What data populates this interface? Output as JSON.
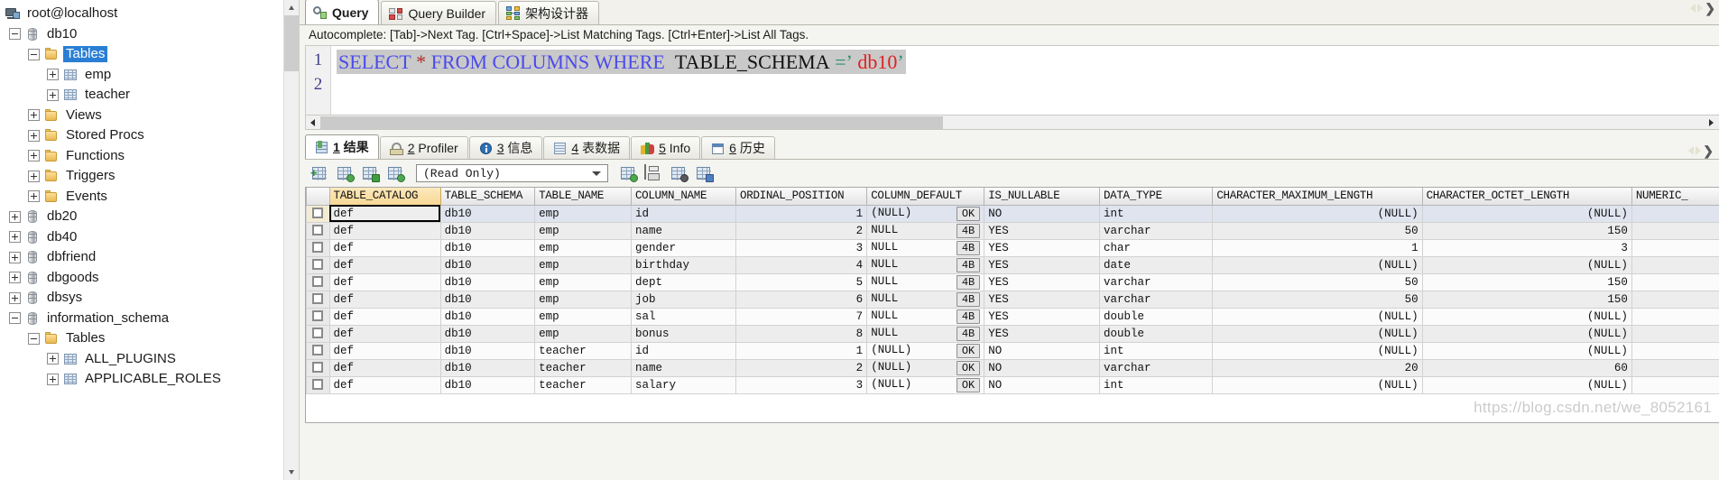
{
  "tree": {
    "root": {
      "label": "root@localhost",
      "icon": "server-icon"
    },
    "items": [
      {
        "label": "db10",
        "icon": "database-icon",
        "indent": 0,
        "expander": "minus",
        "selected": false
      },
      {
        "label": "Tables",
        "icon": "folder-icon",
        "indent": 1,
        "expander": "minus",
        "selected": true
      },
      {
        "label": "emp",
        "icon": "table-icon",
        "indent": 2,
        "expander": "plus",
        "selected": false
      },
      {
        "label": "teacher",
        "icon": "table-icon",
        "indent": 2,
        "expander": "plus",
        "selected": false
      },
      {
        "label": "Views",
        "icon": "folder-icon",
        "indent": 1,
        "expander": "plus",
        "selected": false
      },
      {
        "label": "Stored Procs",
        "icon": "folder-icon",
        "indent": 1,
        "expander": "plus",
        "selected": false
      },
      {
        "label": "Functions",
        "icon": "folder-icon",
        "indent": 1,
        "expander": "plus",
        "selected": false
      },
      {
        "label": "Triggers",
        "icon": "folder-icon",
        "indent": 1,
        "expander": "plus",
        "selected": false
      },
      {
        "label": "Events",
        "icon": "folder-icon",
        "indent": 1,
        "expander": "plus",
        "selected": false
      },
      {
        "label": "db20",
        "icon": "database-icon",
        "indent": 0,
        "expander": "plus",
        "selected": false
      },
      {
        "label": "db40",
        "icon": "database-icon",
        "indent": 0,
        "expander": "plus",
        "selected": false
      },
      {
        "label": "dbfriend",
        "icon": "database-icon",
        "indent": 0,
        "expander": "plus",
        "selected": false
      },
      {
        "label": "dbgoods",
        "icon": "database-icon",
        "indent": 0,
        "expander": "plus",
        "selected": false
      },
      {
        "label": "dbsys",
        "icon": "database-icon",
        "indent": 0,
        "expander": "plus",
        "selected": false
      },
      {
        "label": "information_schema",
        "icon": "database-icon",
        "indent": 0,
        "expander": "minus",
        "selected": false
      },
      {
        "label": "Tables",
        "icon": "folder-icon",
        "indent": 1,
        "expander": "minus",
        "selected": false
      },
      {
        "label": "ALL_PLUGINS",
        "icon": "table-icon",
        "indent": 2,
        "expander": "plus",
        "selected": false
      },
      {
        "label": "APPLICABLE_ROLES",
        "icon": "table-icon",
        "indent": 2,
        "expander": "plus",
        "selected": false
      }
    ]
  },
  "editor_tabs": [
    {
      "label": "Query",
      "icon": "query-icon",
      "active": true
    },
    {
      "label": "Query Builder",
      "icon": "query-builder-icon",
      "active": false
    },
    {
      "label": "架构设计器",
      "icon": "schema-designer-icon",
      "active": false
    }
  ],
  "autocomplete_hint": "Autocomplete: [Tab]->Next Tag. [Ctrl+Space]->List Matching Tags. [Ctrl+Enter]->List All Tags.",
  "sql": {
    "line_numbers": [
      "1",
      "2"
    ],
    "tokens": [
      {
        "text": "SELECT",
        "kind": "kw"
      },
      {
        "text": " ",
        "kind": "plain"
      },
      {
        "text": "*",
        "kind": "star"
      },
      {
        "text": " ",
        "kind": "plain"
      },
      {
        "text": "FROM",
        "kind": "kw"
      },
      {
        "text": " ",
        "kind": "plain"
      },
      {
        "text": "COLUMNS",
        "kind": "kw"
      },
      {
        "text": " ",
        "kind": "plain"
      },
      {
        "text": "WHERE",
        "kind": "kw"
      },
      {
        "text": "  ",
        "kind": "plain"
      },
      {
        "text": "TABLE_SCHEMA",
        "kind": "ident"
      },
      {
        "text": " ",
        "kind": "plain"
      },
      {
        "text": "=",
        "kind": "op"
      },
      {
        "text": "’",
        "kind": "quote"
      },
      {
        "text": " db10",
        "kind": "strlit"
      },
      {
        "text": "’",
        "kind": "quote"
      }
    ],
    "full_text": "SELECT * FROM COLUMNS WHERE  TABLE_SCHEMA =’ db10’"
  },
  "result_tabs": [
    {
      "num": "1",
      "label": "结果",
      "icon": "result-grid-icon",
      "active": true
    },
    {
      "num": "2",
      "label": "Profiler",
      "icon": "profiler-icon",
      "active": false
    },
    {
      "num": "3",
      "label": "信息",
      "icon": "info-icon",
      "active": false
    },
    {
      "num": "4",
      "label": "表数据",
      "icon": "table-data-icon",
      "active": false
    },
    {
      "num": "5",
      "label": "Info",
      "icon": "chart-icon",
      "active": false
    },
    {
      "num": "6",
      "label": "历史",
      "icon": "history-calendar-icon",
      "active": false
    }
  ],
  "grid_toolbar": {
    "buttons": [
      {
        "name": "add-row-icon"
      },
      {
        "name": "duplicate-row-icon"
      },
      {
        "name": "copy-row-icon"
      },
      {
        "name": "insert-row-icon"
      },
      {
        "name": "refresh-grid-icon"
      },
      {
        "name": "save-grid-icon"
      },
      {
        "name": "remove-row-icon"
      },
      {
        "name": "export-grid-icon"
      }
    ],
    "mode_select": {
      "value": "(Read Only)"
    }
  },
  "grid": {
    "columns": [
      "TABLE_CATALOG",
      "TABLE_SCHEMA",
      "TABLE_NAME",
      "COLUMN_NAME",
      "ORDINAL_POSITION",
      "COLUMN_DEFAULT",
      "IS_NULLABLE",
      "DATA_TYPE",
      "CHARACTER_MAXIMUM_LENGTH",
      "CHARACTER_OCTET_LENGTH",
      "NUMERIC_"
    ],
    "highlighted_column": "TABLE_CATALOG",
    "rows": [
      {
        "TABLE_CATALOG": "def",
        "TABLE_SCHEMA": "db10",
        "TABLE_NAME": "emp",
        "COLUMN_NAME": "id",
        "ORDINAL_POSITION": "1",
        "COLUMN_DEFAULT": "(NULL)",
        "COLUMN_DEFAULT_BADGE": "OK",
        "IS_NULLABLE": "NO",
        "DATA_TYPE": "int",
        "CHARACTER_MAXIMUM_LENGTH": "(NULL)",
        "CHARACTER_OCTET_LENGTH": "(NULL)",
        "NUMERIC_": ""
      },
      {
        "TABLE_CATALOG": "def",
        "TABLE_SCHEMA": "db10",
        "TABLE_NAME": "emp",
        "COLUMN_NAME": "name",
        "ORDINAL_POSITION": "2",
        "COLUMN_DEFAULT": "NULL",
        "COLUMN_DEFAULT_BADGE": "4B",
        "IS_NULLABLE": "YES",
        "DATA_TYPE": "varchar",
        "CHARACTER_MAXIMUM_LENGTH": "50",
        "CHARACTER_OCTET_LENGTH": "150",
        "NUMERIC_": ""
      },
      {
        "TABLE_CATALOG": "def",
        "TABLE_SCHEMA": "db10",
        "TABLE_NAME": "emp",
        "COLUMN_NAME": "gender",
        "ORDINAL_POSITION": "3",
        "COLUMN_DEFAULT": "NULL",
        "COLUMN_DEFAULT_BADGE": "4B",
        "IS_NULLABLE": "YES",
        "DATA_TYPE": "char",
        "CHARACTER_MAXIMUM_LENGTH": "1",
        "CHARACTER_OCTET_LENGTH": "3",
        "NUMERIC_": ""
      },
      {
        "TABLE_CATALOG": "def",
        "TABLE_SCHEMA": "db10",
        "TABLE_NAME": "emp",
        "COLUMN_NAME": "birthday",
        "ORDINAL_POSITION": "4",
        "COLUMN_DEFAULT": "NULL",
        "COLUMN_DEFAULT_BADGE": "4B",
        "IS_NULLABLE": "YES",
        "DATA_TYPE": "date",
        "CHARACTER_MAXIMUM_LENGTH": "(NULL)",
        "CHARACTER_OCTET_LENGTH": "(NULL)",
        "NUMERIC_": ""
      },
      {
        "TABLE_CATALOG": "def",
        "TABLE_SCHEMA": "db10",
        "TABLE_NAME": "emp",
        "COLUMN_NAME": "dept",
        "ORDINAL_POSITION": "5",
        "COLUMN_DEFAULT": "NULL",
        "COLUMN_DEFAULT_BADGE": "4B",
        "IS_NULLABLE": "YES",
        "DATA_TYPE": "varchar",
        "CHARACTER_MAXIMUM_LENGTH": "50",
        "CHARACTER_OCTET_LENGTH": "150",
        "NUMERIC_": ""
      },
      {
        "TABLE_CATALOG": "def",
        "TABLE_SCHEMA": "db10",
        "TABLE_NAME": "emp",
        "COLUMN_NAME": "job",
        "ORDINAL_POSITION": "6",
        "COLUMN_DEFAULT": "NULL",
        "COLUMN_DEFAULT_BADGE": "4B",
        "IS_NULLABLE": "YES",
        "DATA_TYPE": "varchar",
        "CHARACTER_MAXIMUM_LENGTH": "50",
        "CHARACTER_OCTET_LENGTH": "150",
        "NUMERIC_": ""
      },
      {
        "TABLE_CATALOG": "def",
        "TABLE_SCHEMA": "db10",
        "TABLE_NAME": "emp",
        "COLUMN_NAME": "sal",
        "ORDINAL_POSITION": "7",
        "COLUMN_DEFAULT": "NULL",
        "COLUMN_DEFAULT_BADGE": "4B",
        "IS_NULLABLE": "YES",
        "DATA_TYPE": "double",
        "CHARACTER_MAXIMUM_LENGTH": "(NULL)",
        "CHARACTER_OCTET_LENGTH": "(NULL)",
        "NUMERIC_": ""
      },
      {
        "TABLE_CATALOG": "def",
        "TABLE_SCHEMA": "db10",
        "TABLE_NAME": "emp",
        "COLUMN_NAME": "bonus",
        "ORDINAL_POSITION": "8",
        "COLUMN_DEFAULT": "NULL",
        "COLUMN_DEFAULT_BADGE": "4B",
        "IS_NULLABLE": "YES",
        "DATA_TYPE": "double",
        "CHARACTER_MAXIMUM_LENGTH": "(NULL)",
        "CHARACTER_OCTET_LENGTH": "(NULL)",
        "NUMERIC_": ""
      },
      {
        "TABLE_CATALOG": "def",
        "TABLE_SCHEMA": "db10",
        "TABLE_NAME": "teacher",
        "COLUMN_NAME": "id",
        "ORDINAL_POSITION": "1",
        "COLUMN_DEFAULT": "(NULL)",
        "COLUMN_DEFAULT_BADGE": "OK",
        "IS_NULLABLE": "NO",
        "DATA_TYPE": "int",
        "CHARACTER_MAXIMUM_LENGTH": "(NULL)",
        "CHARACTER_OCTET_LENGTH": "(NULL)",
        "NUMERIC_": ""
      },
      {
        "TABLE_CATALOG": "def",
        "TABLE_SCHEMA": "db10",
        "TABLE_NAME": "teacher",
        "COLUMN_NAME": "name",
        "ORDINAL_POSITION": "2",
        "COLUMN_DEFAULT": "(NULL)",
        "COLUMN_DEFAULT_BADGE": "OK",
        "IS_NULLABLE": "NO",
        "DATA_TYPE": "varchar",
        "CHARACTER_MAXIMUM_LENGTH": "20",
        "CHARACTER_OCTET_LENGTH": "60",
        "NUMERIC_": ""
      },
      {
        "TABLE_CATALOG": "def",
        "TABLE_SCHEMA": "db10",
        "TABLE_NAME": "teacher",
        "COLUMN_NAME": "salary",
        "ORDINAL_POSITION": "3",
        "COLUMN_DEFAULT": "(NULL)",
        "COLUMN_DEFAULT_BADGE": "OK",
        "IS_NULLABLE": "NO",
        "DATA_TYPE": "int",
        "CHARACTER_MAXIMUM_LENGTH": "(NULL)",
        "CHARACTER_OCTET_LENGTH": "(NULL)",
        "NUMERIC_": ""
      }
    ]
  },
  "watermark": "https://blog.csdn.net/we_8052161"
}
